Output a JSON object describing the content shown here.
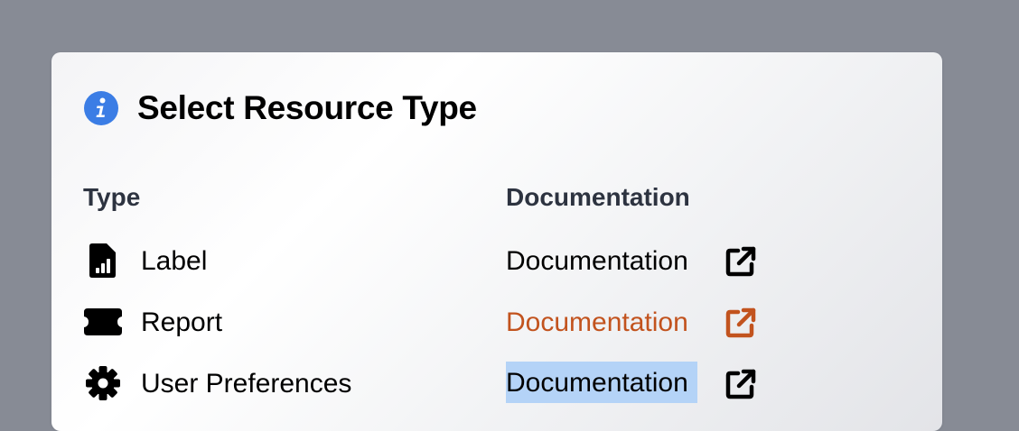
{
  "dialog": {
    "title": "Select Resource Type",
    "icon": "info-circle-icon",
    "accent_color": "#3b7de5"
  },
  "table": {
    "headers": {
      "type": "Type",
      "documentation": "Documentation"
    },
    "rows": [
      {
        "icon": "file-chart-icon",
        "type": "Label",
        "doc_label": "Documentation",
        "doc_state": "normal",
        "ext_icon": "external-link-icon"
      },
      {
        "icon": "ticket-icon",
        "type": "Report",
        "doc_label": "Documentation",
        "doc_state": "hover",
        "ext_icon": "external-link-icon"
      },
      {
        "icon": "gear-icon",
        "type": "User Preferences",
        "doc_label": "Documentation",
        "doc_state": "selected",
        "ext_icon": "external-link-icon"
      }
    ]
  },
  "colors": {
    "backdrop": "#878b95",
    "link_hover": "#c2531e",
    "selection": "#b4d3f7",
    "header_text": "#2d3340"
  }
}
